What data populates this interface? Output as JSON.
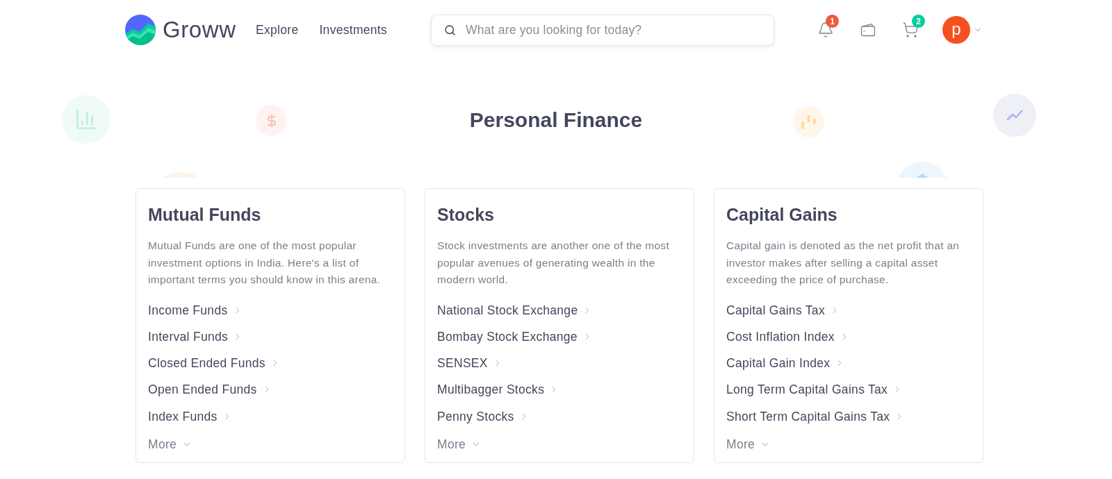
{
  "header": {
    "logo_text": "Groww",
    "nav": [
      "Explore",
      "Investments"
    ],
    "search": {
      "placeholder": "What are you looking for today?"
    },
    "notifications": {
      "count": "1"
    },
    "cart": {
      "count": "2"
    },
    "avatar": {
      "initial": "p"
    }
  },
  "title": "Personal Finance",
  "cards": [
    {
      "title": "Mutual Funds",
      "description": "Mutual Funds are one of the most popular investment options in India. Here's a list of important terms you should know in this arena.",
      "links": [
        "Income Funds",
        "Interval Funds",
        "Closed Ended Funds",
        "Open Ended Funds",
        "Index Funds"
      ],
      "more": "More"
    },
    {
      "title": "Stocks",
      "description": "Stock investments are another one of the most popular avenues of generating wealth in the modern world.",
      "links": [
        "National Stock Exchange",
        "Bombay Stock Exchange",
        "SENSEX",
        "Multibagger Stocks",
        "Penny Stocks"
      ],
      "more": "More"
    },
    {
      "title": "Capital Gains",
      "description": "Capital gain is denoted as the net profit that an investor makes after selling a capital asset exceeding the price of purchase.",
      "links": [
        "Capital Gains Tax",
        "Cost Inflation Index",
        "Capital Gain Index",
        "Long Term Capital Gains Tax",
        "Short Term Capital Gains Tax"
      ],
      "more": "More"
    }
  ]
}
